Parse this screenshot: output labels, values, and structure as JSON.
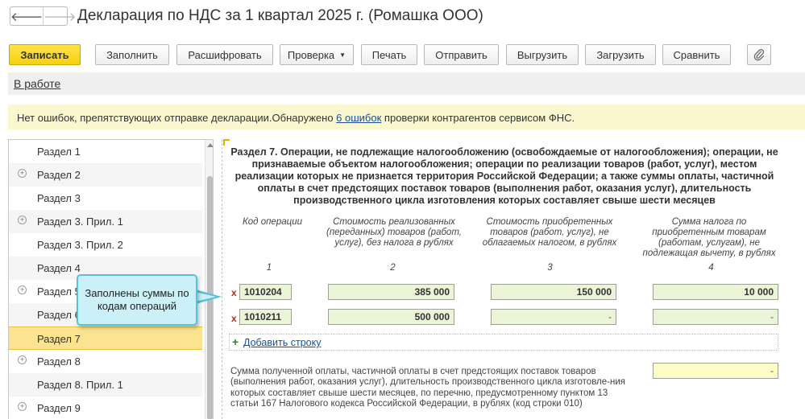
{
  "window": {
    "title": "Декларация по НДС за 1 квартал 2025 г. (Ромашка ООО)",
    "nav_back": "🡐",
    "nav_forward": "🡒"
  },
  "toolbar": {
    "save": "Записать",
    "fill": "Заполнить",
    "decode": "Расшифровать",
    "check": "Проверка",
    "print": "Печать",
    "send": "Отправить",
    "export": "Выгрузить",
    "import": "Загрузить",
    "compare": "Сравнить",
    "attach_icon": "paperclip-icon"
  },
  "status": {
    "state": "В работе"
  },
  "info": {
    "text_before": "Нет ошибок, препятствующих отправке декларации.Обнаружено ",
    "link": "6 ошибок",
    "text_after": " проверки контрагентов сервисом ФНС."
  },
  "sidebar": {
    "items": [
      {
        "label": "Раздел 1",
        "expandable": false
      },
      {
        "label": "Раздел 2",
        "expandable": true
      },
      {
        "label": "Раздел 3",
        "expandable": false
      },
      {
        "label": "Раздел 3. Прил. 1",
        "expandable": true
      },
      {
        "label": "Раздел 3. Прил. 2",
        "expandable": false
      },
      {
        "label": "Раздел 4",
        "expandable": false
      },
      {
        "label": "Раздел 5",
        "expandable": true
      },
      {
        "label": "Раздел 6",
        "expandable": false
      },
      {
        "label": "Раздел 7",
        "expandable": false,
        "selected": true
      },
      {
        "label": "Раздел 8",
        "expandable": true
      },
      {
        "label": "Раздел 8. Прил. 1",
        "expandable": false
      },
      {
        "label": "Раздел 9",
        "expandable": true
      }
    ]
  },
  "callout": {
    "text": "Заполнены суммы по кодам операций"
  },
  "section": {
    "heading": "Раздел 7. Операции, не подлежащие налогообложению (освобождаемые от налогообложения); операции, не признаваемые объектом налогообложения; операции по реализации товаров (работ, услуг), местом реализации которых не признается территория Российской Федерации; а также суммы оплаты, частичной оплаты в счет предстоящих поставок товаров (выполнения работ, оказания услуг), длительность производственного цикла изготовления которых составляет свыше шести месяцев",
    "columns": [
      {
        "title": "Код операции",
        "number": "1"
      },
      {
        "title": "Стоимость реализованных (переданных) товаров (работ, услуг), без налога в рублях",
        "number": "2"
      },
      {
        "title": "Стоимость приобретенных товаров (работ, услуг), не облагаемых налогом, в рублях",
        "number": "3"
      },
      {
        "title": "Сумма налога по приобретенным товарам (работам, услугам), не подлежащая вычету, в рублях",
        "number": "4"
      }
    ],
    "rows": [
      {
        "mark": "x",
        "code": "1010204",
        "col2": "385 000",
        "col3": "150 000",
        "col4": "10 000"
      },
      {
        "mark": "x",
        "code": "1010211",
        "col2": "500 000",
        "col3": "-",
        "col4": "-"
      }
    ],
    "add_row": "Добавить строку",
    "description": "Сумма полученной оплаты, частичной оплаты в счет предстоящих поставок товаров (выполнения работ, оказания услуг), длительность производственного цикла изготовле-ния которых составляет свыше шести месяцев, по перечню, предусмотренному пунктом 13 статьи 167 Налогового кодекса Российской Федерации, в рублях (код строки 010)",
    "description_value": "-"
  },
  "colors": {
    "primary_button": "#f6d10e",
    "selected_item": "#fbe38f",
    "info_bar": "#fbf8cf",
    "field_green": "#eaf4d7",
    "field_yellow": "#fdfbc6",
    "callout_bg": "#cbf0f7",
    "callout_border": "#56c2da",
    "link": "#1a4e9c"
  }
}
